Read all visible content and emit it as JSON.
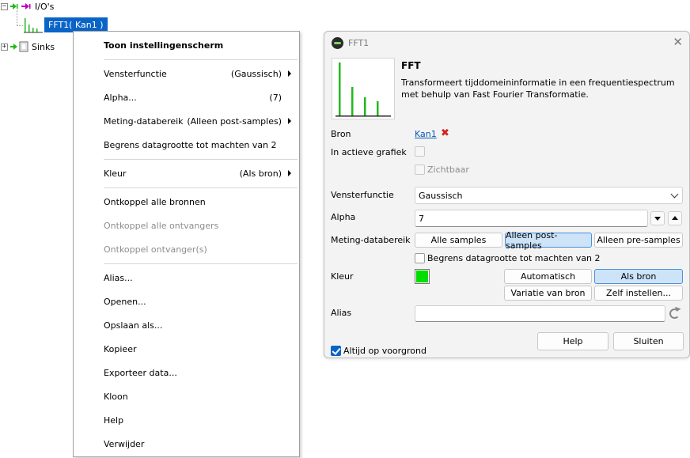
{
  "tree": {
    "ios_label": "I/O's",
    "fft_label": "FFT1( Kan1 )",
    "sinks_label": "Sinks",
    "ios_expander": "−",
    "sinks_expander": "+"
  },
  "context_menu": {
    "header": "Toon instellingenscherm",
    "vensterfunctie": {
      "label": "Vensterfunctie",
      "value": "(Gaussisch)"
    },
    "alpha": {
      "label": "Alpha...",
      "value": "(7)"
    },
    "meting": {
      "label": "Meting-databereik",
      "value": "(Alleen post-samples)"
    },
    "begrens": "Begrens datagrootte tot machten van 2",
    "kleur": {
      "label": "Kleur",
      "value": "(Als bron)"
    },
    "ontkoppel_bronnen": "Ontkoppel alle bronnen",
    "ontkoppel_ontvangers": "Ontkoppel alle ontvangers",
    "ontkoppel_ontvanger": "Ontkoppel ontvanger(s)",
    "alias": "Alias...",
    "openen": "Openen...",
    "opslaan": "Opslaan als...",
    "kopieer": "Kopieer",
    "exporteer": "Exporteer data...",
    "kloon": "Kloon",
    "help": "Help",
    "verwijder": "Verwijder"
  },
  "dialog": {
    "title": "FFT1",
    "close": "✕",
    "heading": "FFT",
    "description": "Transformeert tijddomeininformatie in een frequentiespectrum met behulp van Fast Fourier Transformatie.",
    "bron_label": "Bron",
    "bron_link": "Kan1",
    "remove_icon": "✖",
    "actieve_grafiek_label": "In actieve grafiek",
    "zichtbaar_label": "Zichtbaar",
    "vensterfunctie_label": "Vensterfunctie",
    "vensterfunctie_value": "Gaussisch",
    "alpha_label": "Alpha",
    "alpha_value": "7",
    "meting_label": "Meting-databereik",
    "btn_alle": "Alle samples",
    "btn_post": "Alleen post-samples",
    "btn_pre": "Alleen pre-samples",
    "begrens_label": "Begrens datagrootte tot machten van 2",
    "kleur_label": "Kleur",
    "btn_automatisch": "Automatisch",
    "btn_als_bron": "Als bron",
    "btn_variatie": "Variatie van bron",
    "btn_zelf": "Zelf instellen...",
    "alias_label": "Alias",
    "alias_value": "",
    "altijd_label": "Altijd op voorgrond",
    "btn_help": "Help",
    "btn_sluiten": "Sluiten"
  },
  "colors": {
    "kleur_swatch": "#00dd00",
    "selection": "#0a64c8",
    "remove_red": "#d42020",
    "spectrum_green": "#22b81c"
  },
  "icons": {
    "ios": "io-arrows-icon",
    "fft": "fft-spectrum-icon",
    "sinks": "sink-arrow-icon",
    "remove": "red-x-icon",
    "reset": "reset-icon",
    "dialog": "app-icon"
  }
}
